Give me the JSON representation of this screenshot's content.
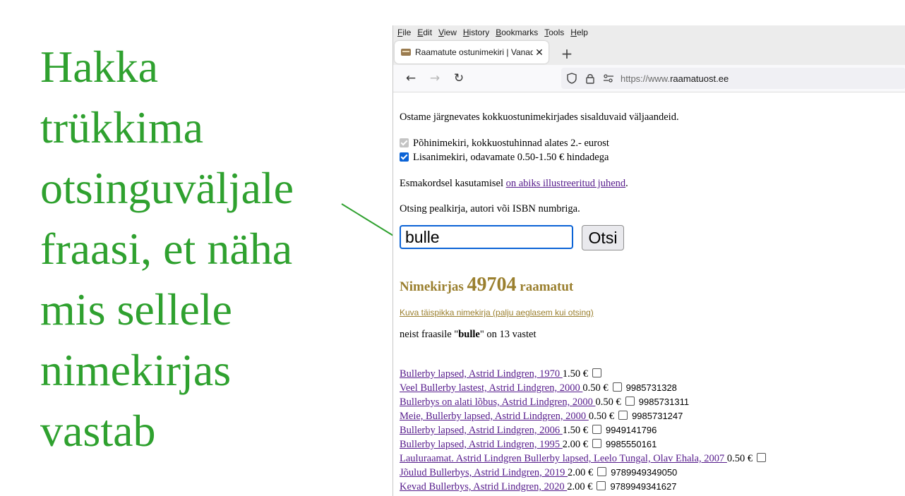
{
  "caption": {
    "lines": [
      "Hakka",
      "trükkima",
      "otsinguväljale",
      "fraasi, et näha",
      "mis sellele",
      "nimekirjas",
      "vastab"
    ]
  },
  "menubar": [
    "File",
    "Edit",
    "View",
    "History",
    "Bookmarks",
    "Tools",
    "Help"
  ],
  "tab": {
    "title": "Raamatute ostunimekiri | Vanad",
    "close_icon": "close-icon",
    "favicon": "books-icon"
  },
  "newtab_label": "+",
  "navbar": {
    "back": "←",
    "forward": "→",
    "reload": "↻"
  },
  "url": {
    "prefix": "https://www.",
    "host": "raamatuost.ee"
  },
  "page": {
    "intro": "Ostame järgnevates kokkuostunimekirjades sisalduvaid väljaandeid.",
    "lists": [
      {
        "label": "Põhinimekiri, kokkuostuhinnad alates 2.- eurost",
        "checked": true,
        "disabled": true
      },
      {
        "label": "Lisanimekiri, odavamate 0.50-1.50 € hindadega",
        "checked": true,
        "disabled": false
      }
    ],
    "guide_prefix": "Esmakordsel kasutamisel ",
    "guide_link": "on abiks illustreeritud juhend",
    "guide_suffix": ".",
    "search_hint": "Otsing pealkirja, autori või ISBN numbriga.",
    "search_value": "bulle",
    "search_button": "Otsi",
    "count_prefix": "Nimekirjas ",
    "count_number": "49704",
    "count_suffix": " raamatut",
    "full_list_link": "Kuva täispikka nimekirja (palju aeglasem kui otsing)",
    "matches_prefix": "neist fraasile \"",
    "matches_phrase": "bulle",
    "matches_suffix": "\" on 13 vastet"
  },
  "results": [
    {
      "title": "Bullerby lapsed, Astrid Lindgren, 1970 ",
      "price": "1.50 €",
      "isbn": ""
    },
    {
      "title": "Veel Bullerby lastest, Astrid Lindgren, 2000 ",
      "price": "0.50 €",
      "isbn": "9985731328"
    },
    {
      "title": "Bullerbys on alati lõbus, Astrid Lindgren, 2000 ",
      "price": "0.50 €",
      "isbn": "9985731311"
    },
    {
      "title": "Meie, Bullerby lapsed, Astrid Lindgren, 2000 ",
      "price": "0.50 €",
      "isbn": "9985731247"
    },
    {
      "title": "Bullerby lapsed, Astrid Lindgren, 2006 ",
      "price": "1.50 €",
      "isbn": "9949141796"
    },
    {
      "title": "Bullerby lapsed, Astrid Lindgren, 1995 ",
      "price": "2.00 €",
      "isbn": "9985550161"
    },
    {
      "title": "Lauluraamat. Astrid Lindgren Bullerby lapsed, Leelo Tungal, Olav Ehala, 2007 ",
      "price": "0.50 €",
      "isbn": ""
    },
    {
      "title": "Jõulud Bullerbys, Astrid Lindgren, 2019 ",
      "price": "2.00 €",
      "isbn": "9789949349050"
    },
    {
      "title": "Kevad Bullerbys, Astrid Lindgren, 2020 ",
      "price": "2.00 €",
      "isbn": "9789949341627"
    }
  ],
  "colors": {
    "caption": "#2fa12f",
    "accent": "#0b63d6",
    "count": "#9a7f2e",
    "link": "#551a8b"
  }
}
